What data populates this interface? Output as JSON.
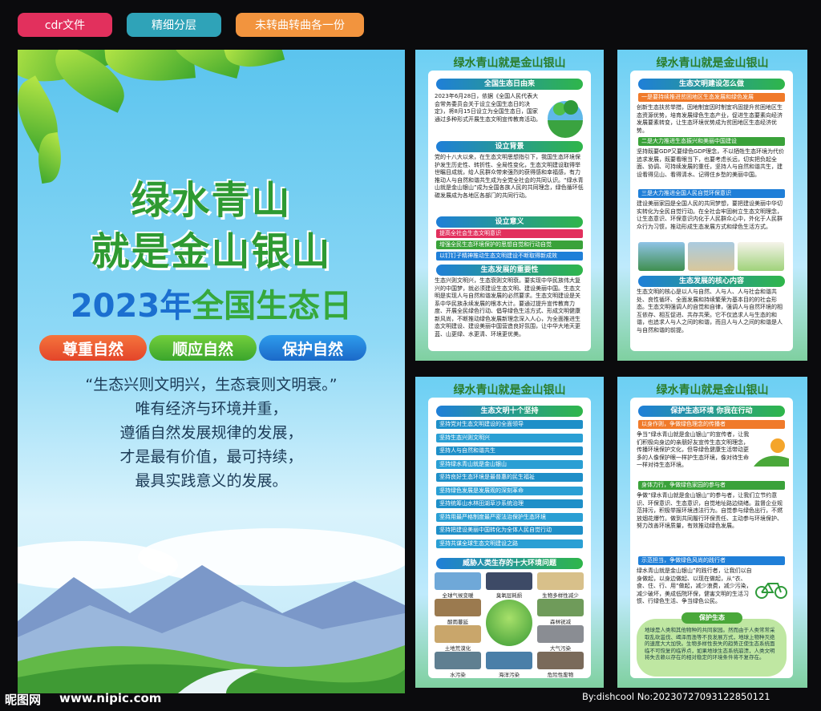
{
  "tags": [
    "cdr文件",
    "精细分层",
    "未转曲转曲各一份"
  ],
  "main": {
    "title_line1": "绿水青山",
    "title_line2": "就是金山银山",
    "year_title_a": "2023年",
    "year_title_b": "全国生态日",
    "pills": [
      "尊重自然",
      "顺应自然",
      "保护自然"
    ],
    "quote": [
      "“生态兴则文明兴，生态衰则文明衰。”",
      "唯有经济与环境并重，",
      "遵循自然发展规律的发展，",
      "才是最有价值，最可持续，",
      "最具实践意义的发展。"
    ]
  },
  "header_title": "绿水青山就是金山银山",
  "panel1": {
    "sections": [
      {
        "title": "全国生态日由来",
        "text": "2023年6月28日，依据《全国人民代表大会常务委员会关于设立全国生态日的决定》，将8月15日设立为全国生态日，国家通过多种形式开展生态文明宣传教育活动。"
      },
      {
        "title": "设立背景",
        "text": "党的十八大以来，在生态文明思想指引下，我国生态环境保护发生历史性、转折性、全局性变化，生态文明建设取得举世瞩目成就，给人民群众带来强烈的获得感和幸福感，有力推动人与自然和谐共生成为全党全社会的共同认识。“绿水青山就是金山银山”成为全国各族人民的共同理念，绿色循环低碳发展成为各地区各部门的共同行动。"
      },
      {
        "title": "设立意义",
        "bars": [
          "提高全社会生态文明意识",
          "增强全民生态环境保护的思想自觉和行动自觉",
          "以钉钉子精神推动生态文明建设不断取得新成效"
        ]
      },
      {
        "title": "生态发展的重要性",
        "text": "生态兴则文明兴，生态衰则文明衰。要实现中华民族伟大复兴的中国梦，就必须建设生态文明、建设美丽中国。生态文明是实现人与自然和谐发展的必然要求。生态文明建设是关系中华民族永续发展的根本大计。要通过提升宣传教育力度、开展全民绿色行动、倡导绿色生活方式、形成文明健康新风尚，不断推动绿色发展新理念深入人心，为全面推进生态文明建设、建设美丽中国营造良好氛围，让中华大地天更蓝、山更绿、水更清、环境更优美。"
      }
    ]
  },
  "panel2": {
    "sections": [
      {
        "title": "生态文明建设怎么做",
        "sub": "一是要持续推进贫困地区生态发展和绿色发展",
        "text": "创新生态扶贫举措，因地制宜因时制宜巩固提升贫困地区生态资源优势，培育发展绿色生态产业，促进生态要素向经济发展要素转变，让生态环境优势成为贫困地区生态经济优势。"
      },
      {
        "sub": "二是大力推进生态振兴和美丽中国建设",
        "text": "坚持既要GDP又要绿色GDP理念，不以牺牲生态环境为代价追求发展，既要看眼当下，也要考虑长远，切实把负起全面、协调、可持续发展的重任，坚持人与自然和谐共生，建设看得见山、看得清水、记得住乡愁的美丽中国。"
      },
      {
        "sub": "三是大力推进全国人民自觉环保意识",
        "text": "建设美丽家园是全国人民的共同梦想，要把建设美丽中华切实转化为全民自觉行动。在全社会牢固树立生态文明理念，让生态意识、环保意识内化于人民群众心中，外化于人民群众行为习惯，推动形成生态发展方式和绿色生活方式。"
      },
      {
        "title": "生态发展的核心内容",
        "text": "生态文明的核心是以人与自然、人与人、人与社会和谐共处、良性循环、全面发展和持续繁荣为基本目的的社会形态。生态文明强调人的自觉和自律，强调人与自然环境的相互依存、相互促进、共存共荣。它不仅追求人与生态的和谐，也追求人与人之间的和谐，而且人与人之间的和谐是人与自然和谐的前提。"
      }
    ]
  },
  "panel3": {
    "title1": "生态文明十个坚持",
    "items": [
      "坚持党对生态文明建设的全面领导",
      "坚持生态兴则文明兴",
      "坚持人与自然和谐共生",
      "坚持绿水青山就是金山银山",
      "坚持良好生态环境是最普惠的民生福祉",
      "坚持绿色发展是发展观的深刻革命",
      "坚持统筹山水林田湖草沙系统治理",
      "坚持用最严格制度最严密法治保护生态环境",
      "坚持把建设美丽中国转化为全体人民自觉行动",
      "坚持共谋全球生态文明建设之路"
    ],
    "title2": "威胁人类生存的十大环境问题",
    "problems": [
      "全球气候变暖",
      "臭氧层耗损",
      "生物多样性减少",
      "酸雨蔓延",
      "森林锐减",
      "土地荒漠化",
      "大气污染",
      "水污染",
      "海洋污染",
      "危险性废物"
    ]
  },
  "panel4": {
    "title": "保护生态环境 你我在行动",
    "sections": [
      {
        "sub": "以身作则，争做绿色理念的传播者",
        "text": "争当“绿水青山就是金山银山”的宣传者，让我们积极向身边的亲朋好友宣传生态文明理念，传播环境保护文化，但导绿色健康生活带动更多的人像保护眼一样护生态环境，像对待生命一样对待生态环境。"
      },
      {
        "sub": "身体力行，争做绿色家园的参与者",
        "text": "争做“绿水青山就是金山银山”的参与者，让我们立节约意识、环保意识、生态意识，自觉地址路边绕绪。监督企业规范排污，积极举报环境违法行为。自觉参与绿色出行，不燃放烟花爆竹。做到共同履行环保责任、主动参与环境保护、努力改善环境质量，有效推动绿色发展。"
      },
      {
        "sub": "示范担当，争做绿色风尚的践行者",
        "text": "绿水青山就是金山银山”的践行者，让我们以自身做起，以身边做起、以现在做起，从“衣、食、住、行、用”做起，减少浪费，减少污染，减少破坏，美成低院环保，健害文明的生活习惯、行绿色生活、争当绿色公民。"
      }
    ],
    "cloud_title": "保护生态",
    "cloud_text": "地球是人类和其他物种的共同家园。然而由于人类常常采取乱砍滥伐、竭泽而渔等不良发展方式，地球上物种灭绝的速度大大加快。生物多样性丧失的趋势正使生态系统面临不可恢复的临界点，如果地球生态系统崩溃，人类文明将失去赖以存在的相对稳定的环境条件将不复存在。"
  },
  "footer": {
    "logo": "昵图网",
    "site": "www.nipic.com",
    "id": "By:dishcool No:20230727093122850121"
  }
}
